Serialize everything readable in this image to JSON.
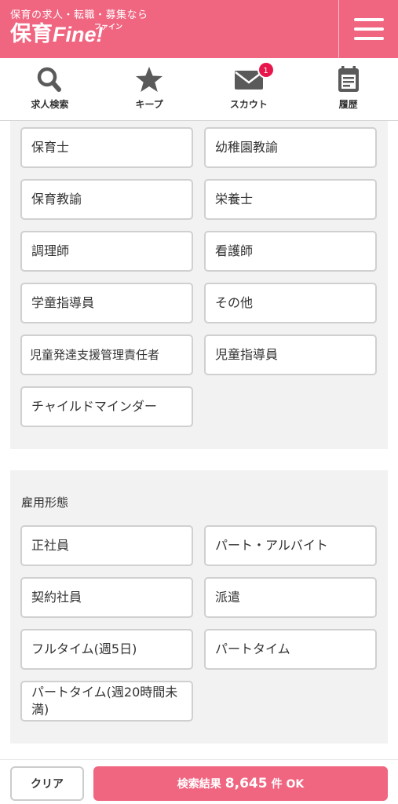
{
  "header": {
    "tagline": "保育の求人・転職・募集なら",
    "logo_jp": "保育",
    "logo_en": "Fine!",
    "logo_ruby": "ファイン",
    "brand_color": "#f06580"
  },
  "nav": {
    "items": [
      {
        "label": "求人検索",
        "icon": "search-icon"
      },
      {
        "label": "キープ",
        "icon": "star-icon"
      },
      {
        "label": "スカウト",
        "icon": "mail-icon",
        "badge": "1"
      },
      {
        "label": "履歴",
        "icon": "calendar-icon"
      }
    ]
  },
  "job_types": {
    "options": [
      "保育士",
      "幼稚園教諭",
      "保育教諭",
      "栄養士",
      "調理師",
      "看護師",
      "学童指導員",
      "その他",
      "児童発達支援管理責任者",
      "児童指導員",
      "チャイルドマインダー"
    ]
  },
  "employment": {
    "title": "雇用形態",
    "options": [
      "正社員",
      "パート・アルバイト",
      "契約社員",
      "派遣",
      "フルタイム(週5日)",
      "パートタイム",
      "パートタイム(週20時間未満)"
    ]
  },
  "footer": {
    "clear_label": "クリア",
    "result_prefix": "検索結果",
    "result_count": "8,645",
    "result_suffix": "件 OK"
  }
}
